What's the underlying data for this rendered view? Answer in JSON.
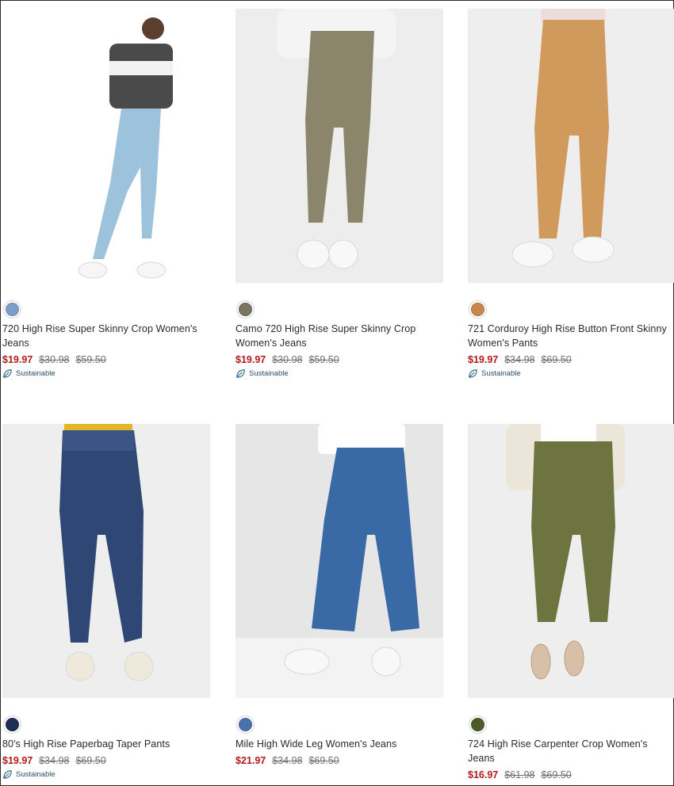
{
  "products": [
    {
      "name": "720 High Rise Super Skinny Crop Women's Jeans",
      "swatch_color": "#7c9fc7",
      "prices": {
        "sale": "$19.97",
        "was": "$30.98",
        "original": "$59.50"
      },
      "sustainable": "Sustainable",
      "image": {
        "background": "#ffffff",
        "pant": "#9cc2dc",
        "top": "#4a4a4a"
      }
    },
    {
      "name": "Camo 720 High Rise Super Skinny Crop Women's Jeans",
      "swatch_color": "#7a7560",
      "prices": {
        "sale": "$19.97",
        "was": "$30.98",
        "original": "$59.50"
      },
      "sustainable": "Sustainable",
      "image": {
        "background": "#ededed",
        "pant": "#8a856b",
        "top": "#f4f4f4"
      }
    },
    {
      "name": "721 Corduroy High Rise Button Front Skinny Women's Pants",
      "swatch_color": "#c7884d",
      "prices": {
        "sale": "$19.97",
        "was": "$34.98",
        "original": "$69.50"
      },
      "sustainable": "Sustainable",
      "image": {
        "background": "#eeeeee",
        "pant": "#cf9a5c",
        "top": "#eddcdc"
      }
    },
    {
      "name": "80's High Rise Paperbag Taper Pants",
      "swatch_color": "#1f2e55",
      "prices": {
        "sale": "$19.97",
        "was": "$34.98",
        "original": "$69.50"
      },
      "sustainable": "Sustainable",
      "image": {
        "background": "#eeeeee",
        "pant": "#2f4775",
        "top": "#e3b629"
      }
    },
    {
      "name": "Mile High Wide Leg Women's Jeans",
      "swatch_color": "#4c72ad",
      "prices": {
        "sale": "$21.97",
        "was": "$34.98",
        "original": "$69.50"
      },
      "sustainable": "",
      "image": {
        "background": "#e6e6e6",
        "pant": "#3a6aa5",
        "top": "#ffffff"
      }
    },
    {
      "name": "724 High Rise Carpenter Crop Women's Jeans",
      "swatch_color": "#4d5a2a",
      "prices": {
        "sale": "$16.97",
        "was": "$61.98",
        "original": "$69.50"
      },
      "sustainable": "",
      "image": {
        "background": "#eeeeee",
        "pant": "#6e7440",
        "top": "#ece6da"
      }
    }
  ]
}
